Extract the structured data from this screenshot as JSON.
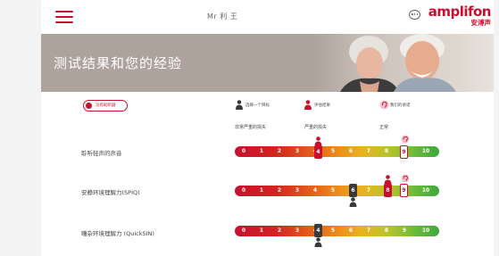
{
  "header": {
    "user": "Mr 利 王",
    "logo_brand": "amplifon",
    "logo_sub": "安溥声"
  },
  "banner": {
    "title": "测试结果和您的经验"
  },
  "legend": {
    "badge": "没有助听器",
    "items": [
      "选择一个目标",
      "评估结果",
      "我们的承诺"
    ]
  },
  "columns": [
    "非常严重的损失",
    "严重的损失",
    "正常"
  ],
  "scale_numbers": [
    "0",
    "1",
    "2",
    "3",
    "4",
    "5",
    "6",
    "7",
    "8",
    "9",
    "10"
  ],
  "rows": [
    {
      "label": "聆听轻声的声音",
      "result": 4,
      "goal": null,
      "promise": 9
    },
    {
      "label": "安静环境理解力(SPIQ)",
      "result": 8,
      "goal": 6,
      "promise": 9
    },
    {
      "label": "嘈杂环境理解力 (QuickSIN)",
      "result": null,
      "goal": 4,
      "promise": null
    }
  ],
  "colors": {
    "brand": "#c8102e",
    "dark": "#3a3a3a",
    "banner": "#aea29c"
  }
}
